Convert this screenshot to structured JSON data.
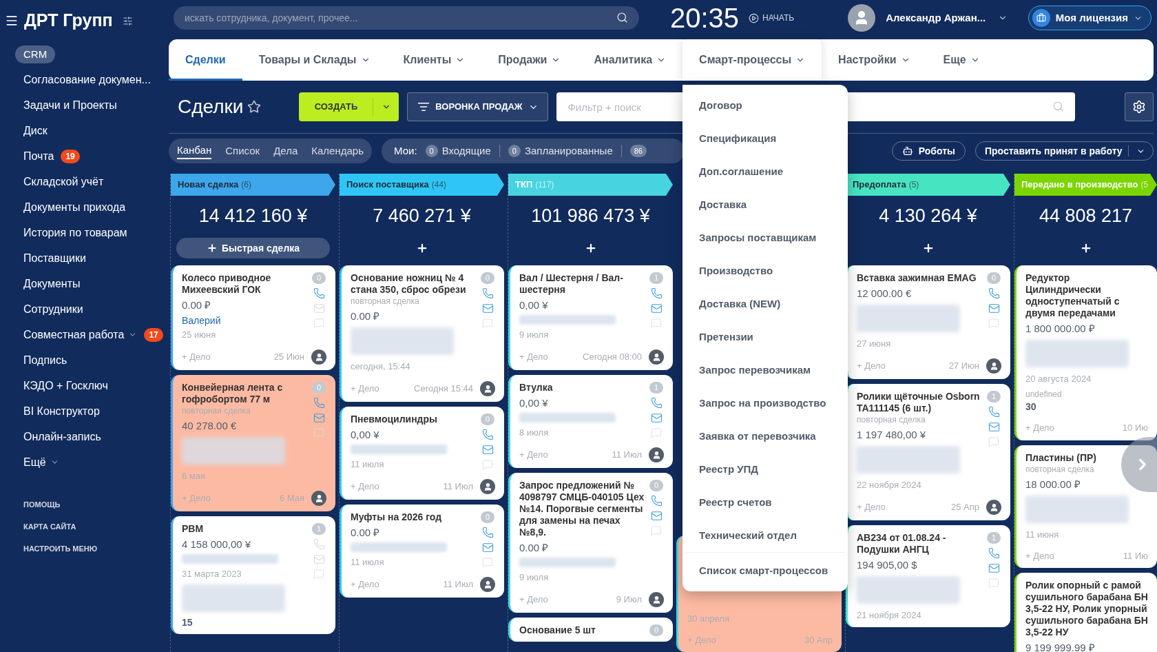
{
  "company": "ДРТ Групп",
  "search": {
    "placeholder": "искать сотрудника, документ, прочее..."
  },
  "clock": "20:35",
  "start_label": "НАЧАТЬ",
  "user": {
    "name": "Александр Аржан..."
  },
  "license": "Моя лицензия",
  "sidebar": {
    "items": [
      {
        "label": "CRM",
        "selected": true
      },
      {
        "label": "Согласование докумен...",
        "selected": false
      },
      {
        "label": "Задачи и Проекты",
        "selected": false
      },
      {
        "label": "Диск",
        "selected": false
      },
      {
        "label": "Почта",
        "selected": false,
        "badge": "19"
      },
      {
        "label": "Складской учёт",
        "selected": false
      },
      {
        "label": "Документы прихода",
        "selected": false
      },
      {
        "label": "История по товарам",
        "selected": false
      },
      {
        "label": "Поставщики",
        "selected": false
      },
      {
        "label": "Документы",
        "selected": false
      },
      {
        "label": "Сотрудники",
        "selected": false
      },
      {
        "label": "Совместная работа",
        "selected": false,
        "has_submenu": true,
        "badge": "17"
      },
      {
        "label": "Подпись",
        "selected": false
      },
      {
        "label": "КЭДО + Госключ",
        "selected": false
      },
      {
        "label": "BI Конструктор",
        "selected": false
      },
      {
        "label": "Онлайн-запись",
        "selected": false
      },
      {
        "label": "Ещё",
        "selected": false,
        "has_submenu": true
      }
    ],
    "footer_links": [
      "ПОМОЩЬ",
      "КАРТА САЙТА",
      "НАСТРОИТЬ МЕНЮ"
    ]
  },
  "nav": [
    {
      "label": "Сделки",
      "selected": true,
      "has_menu": false,
      "expanded": false
    },
    {
      "label": "Товары и Склады",
      "selected": false,
      "has_menu": true,
      "expanded": false
    },
    {
      "label": "Клиенты",
      "selected": false,
      "has_menu": true,
      "expanded": false
    },
    {
      "label": "Продажи",
      "selected": false,
      "has_menu": true,
      "expanded": false
    },
    {
      "label": "Аналитика",
      "selected": false,
      "has_menu": true,
      "expanded": false
    },
    {
      "label": "Смарт-процессы",
      "selected": false,
      "has_menu": true,
      "expanded": true,
      "menu": [
        "Договор",
        "Спецификация",
        "Доп.соглашение",
        "Доставка",
        "Запросы поставщикам",
        "Производство",
        "Доставка (NEW)",
        "Претензии",
        "Запрос перевозчикам",
        "Запрос на производство",
        "Заявка от перевозчика",
        "Реестр УПД",
        "Реестр счетов",
        "Технический отдел"
      ],
      "menu_footer": "Список смарт-процессов"
    },
    {
      "label": "Настройки",
      "selected": false,
      "has_menu": true,
      "expanded": false
    },
    {
      "label": "Еще",
      "selected": false,
      "has_menu": true,
      "expanded": false
    }
  ],
  "toolbar": {
    "title": "Сделки",
    "create": "СОЗДАТЬ",
    "funnel": "ВОРОНКА ПРОДАЖ",
    "filter_placeholder": "Фильтр + поиск"
  },
  "views": [
    {
      "label": "Канбан",
      "selected": true
    },
    {
      "label": "Список",
      "selected": false
    },
    {
      "label": "Дела",
      "selected": false
    },
    {
      "label": "Календарь",
      "selected": false
    }
  ],
  "my_counters": {
    "label": "Мои:",
    "items": [
      {
        "count": "0",
        "label": "Входящие"
      },
      {
        "count": "0",
        "label": "Запланированные"
      },
      {
        "count": "86"
      }
    ]
  },
  "robots": "Роботы",
  "bulk_action": "Проставить принят в работу",
  "columns": [
    {
      "kind": "stage",
      "title": "Новая сделка",
      "count": "(6)",
      "color": "#3ea6ea",
      "light_text": false,
      "sum": "14 412 160 ¥",
      "add_label": "Быстрая сделка",
      "cards": [
        {
          "title": "Колесо приводное Михеевский ГОК",
          "highlighted": false,
          "counter": "0",
          "phone_active": true,
          "mail_active": false,
          "body": [
            {
              "kind": "amount",
              "text": "0.00 ₽"
            },
            {
              "kind": "contact",
              "text": "Валерий"
            },
            {
              "kind": "date",
              "text": "25 июня"
            }
          ],
          "action": "+ Дело",
          "due": "25 Июн"
        },
        {
          "title": "Конвейерная лента с гофробортом 77 м",
          "highlighted": true,
          "counter": "0",
          "phone_active": true,
          "mail_active": true,
          "body": [
            {
              "kind": "subtitle",
              "text": "повторная сделка"
            },
            {
              "kind": "amount",
              "text": "40 278.00 €"
            },
            {
              "kind": "redacted_block"
            },
            {
              "kind": "date",
              "text": "6 мая"
            }
          ],
          "action": "+ Дело",
          "due": "6 Мая"
        },
        {
          "title": "РВМ",
          "highlighted": false,
          "counter": "1",
          "phone_active": false,
          "mail_active": false,
          "body": [
            {
              "kind": "amount",
              "text": "4 158 000,00 ¥"
            },
            {
              "kind": "redacted_line"
            },
            {
              "kind": "date",
              "text": "31 марта 2023"
            },
            {
              "kind": "redacted_block"
            },
            {
              "kind": "note",
              "text": "15"
            }
          ]
        }
      ]
    },
    {
      "kind": "stage",
      "title": "Поиск поставщика",
      "count": "(44)",
      "color": "#2fc6f6",
      "light_text": false,
      "sum": "7 460 271 ¥",
      "cards": [
        {
          "title": "Основание ножниц № 4 стана 350, сброс обрези",
          "highlighted": false,
          "counter": "0",
          "phone_active": true,
          "mail_active": true,
          "body": [
            {
              "kind": "subtitle",
              "text": "повторная сделка"
            },
            {
              "kind": "amount",
              "text": "0.00 ₽"
            },
            {
              "kind": "redacted_block"
            },
            {
              "kind": "date",
              "text": "сегодня, 15:44"
            }
          ],
          "action": "+ Дело",
          "due": "Сегодня 15:44"
        },
        {
          "title": "Пневмоцилиндры",
          "highlighted": false,
          "counter": "0",
          "phone_active": true,
          "mail_active": true,
          "body": [
            {
              "kind": "amount",
              "text": "0,00 ¥"
            },
            {
              "kind": "redacted_line"
            },
            {
              "kind": "date",
              "text": "11 июля"
            }
          ],
          "action": "+ Дело",
          "due": "11 Июл"
        },
        {
          "title": "Муфты на 2026 год",
          "highlighted": false,
          "counter": "0",
          "phone_active": true,
          "mail_active": true,
          "body": [
            {
              "kind": "amount",
              "text": "0.00 ₽"
            },
            {
              "kind": "redacted_line"
            },
            {
              "kind": "date",
              "text": "11 июля"
            }
          ],
          "action": "+ Дело",
          "due": "11 Июл"
        }
      ]
    },
    {
      "kind": "stage",
      "title": "ТКП",
      "count": "(117)",
      "color": "#47d4e0",
      "light_text": true,
      "sum": "101 986 473 ¥",
      "cards": [
        {
          "title": "Вал / Шестерня / Вал-шестерня",
          "highlighted": false,
          "counter": "1",
          "phone_active": true,
          "mail_active": true,
          "body": [
            {
              "kind": "amount",
              "text": "0,00 ¥"
            },
            {
              "kind": "redacted_line"
            },
            {
              "kind": "date",
              "text": "9 июля"
            }
          ],
          "action": "+ Дело",
          "due": "Сегодня 08:00"
        },
        {
          "title": "Втулка",
          "highlighted": false,
          "counter": "1",
          "phone_active": true,
          "mail_active": true,
          "body": [
            {
              "kind": "amount",
              "text": "0,00 ¥"
            },
            {
              "kind": "redacted_line"
            },
            {
              "kind": "date",
              "text": "8 июля"
            }
          ],
          "action": "+ Дело",
          "due": "11 Июл"
        },
        {
          "title": "Запрос предложений № 4098797 СМЦБ-040105 Цех №14. Порогвые сегменты для замены на печах №8,9.",
          "highlighted": false,
          "counter": "0",
          "phone_active": true,
          "mail_active": true,
          "body": [
            {
              "kind": "amount",
              "text": "0.00 ₽"
            },
            {
              "kind": "redacted_line"
            },
            {
              "kind": "date",
              "text": "9 июля"
            }
          ],
          "action": "+ Дело",
          "due": "9 Июл"
        },
        {
          "title": "Основание 5 шт",
          "highlighted": false,
          "counter": "0"
        }
      ]
    },
    {
      "kind": "covered",
      "color": "#47d4e0",
      "cards": [
        {
          "highlighted": true,
          "body": [
            {
              "kind": "date",
              "text": "30 апреля"
            }
          ],
          "action": "+ Дело",
          "due": "30 Апр"
        }
      ]
    },
    {
      "kind": "stage",
      "title": "Предоплата",
      "count": "(5)",
      "color": "#47e4c2",
      "light_text": false,
      "sum": "4 130 264 ¥",
      "cards": [
        {
          "title": "Вставка зажимная EMAG",
          "highlighted": false,
          "counter": "0",
          "phone_active": true,
          "mail_active": true,
          "body": [
            {
              "kind": "amount",
              "text": "12 000.00 €"
            },
            {
              "kind": "redacted_block"
            },
            {
              "kind": "date",
              "text": "27 июня"
            }
          ],
          "action": "+ Дело",
          "due": "27 Июн"
        },
        {
          "title": "Ролики щёточные Osborn TA111145 (6 шт.)",
          "highlighted": false,
          "counter": "1",
          "phone_active": true,
          "mail_active": true,
          "body": [
            {
              "kind": "subtitle",
              "text": "повторная сделка"
            },
            {
              "kind": "amount",
              "text": "1 197 480,00 ¥"
            },
            {
              "kind": "redacted_block"
            },
            {
              "kind": "date",
              "text": "22 ноября 2024"
            }
          ],
          "action": "+ Дело",
          "due": "25 Апр"
        },
        {
          "title": "АВ234 от 01.08.24 - Подушки АНГЦ",
          "highlighted": false,
          "counter": "1",
          "phone_active": true,
          "mail_active": true,
          "body": [
            {
              "kind": "amount",
              "text": "194 905,00 $"
            },
            {
              "kind": "redacted_block"
            },
            {
              "kind": "date",
              "text": "21 ноября 2024"
            }
          ]
        }
      ]
    },
    {
      "kind": "stage",
      "title": "Передано в производство",
      "count": "(5",
      "color": "#7bd500",
      "light_text": true,
      "sum": "44 808 217",
      "cards": [
        {
          "title": "Редуктор Цилиндрически одноступенчатый с двумя передачами",
          "highlighted": false,
          "body": [
            {
              "kind": "amount",
              "text": "1 800 000.00 ₽"
            },
            {
              "kind": "redacted_block"
            },
            {
              "kind": "date",
              "text": "20 августа 2024"
            },
            {
              "kind": "caption",
              "text": "undefined"
            },
            {
              "kind": "note",
              "text": "30"
            }
          ],
          "action": "+ Дело",
          "due": "10 Ию"
        },
        {
          "title": "Пластины (ПР)",
          "highlighted": false,
          "body": [
            {
              "kind": "subtitle",
              "text": "повторная сделка"
            },
            {
              "kind": "amount",
              "text": "18 000.00 ₽"
            },
            {
              "kind": "redacted_block"
            },
            {
              "kind": "date",
              "text": "11 июня"
            }
          ],
          "action": "+ Дело",
          "due": "11 Ию"
        },
        {
          "title": "Ролик опорный с рамой сушильного барабана БН 3,5-22 НУ, Ролик упорный сушильного барабана БН 3,5-22 НУ",
          "highlighted": false,
          "body": [
            {
              "kind": "amount",
              "text": "9 199 999.99 ₽"
            }
          ]
        }
      ]
    }
  ]
}
